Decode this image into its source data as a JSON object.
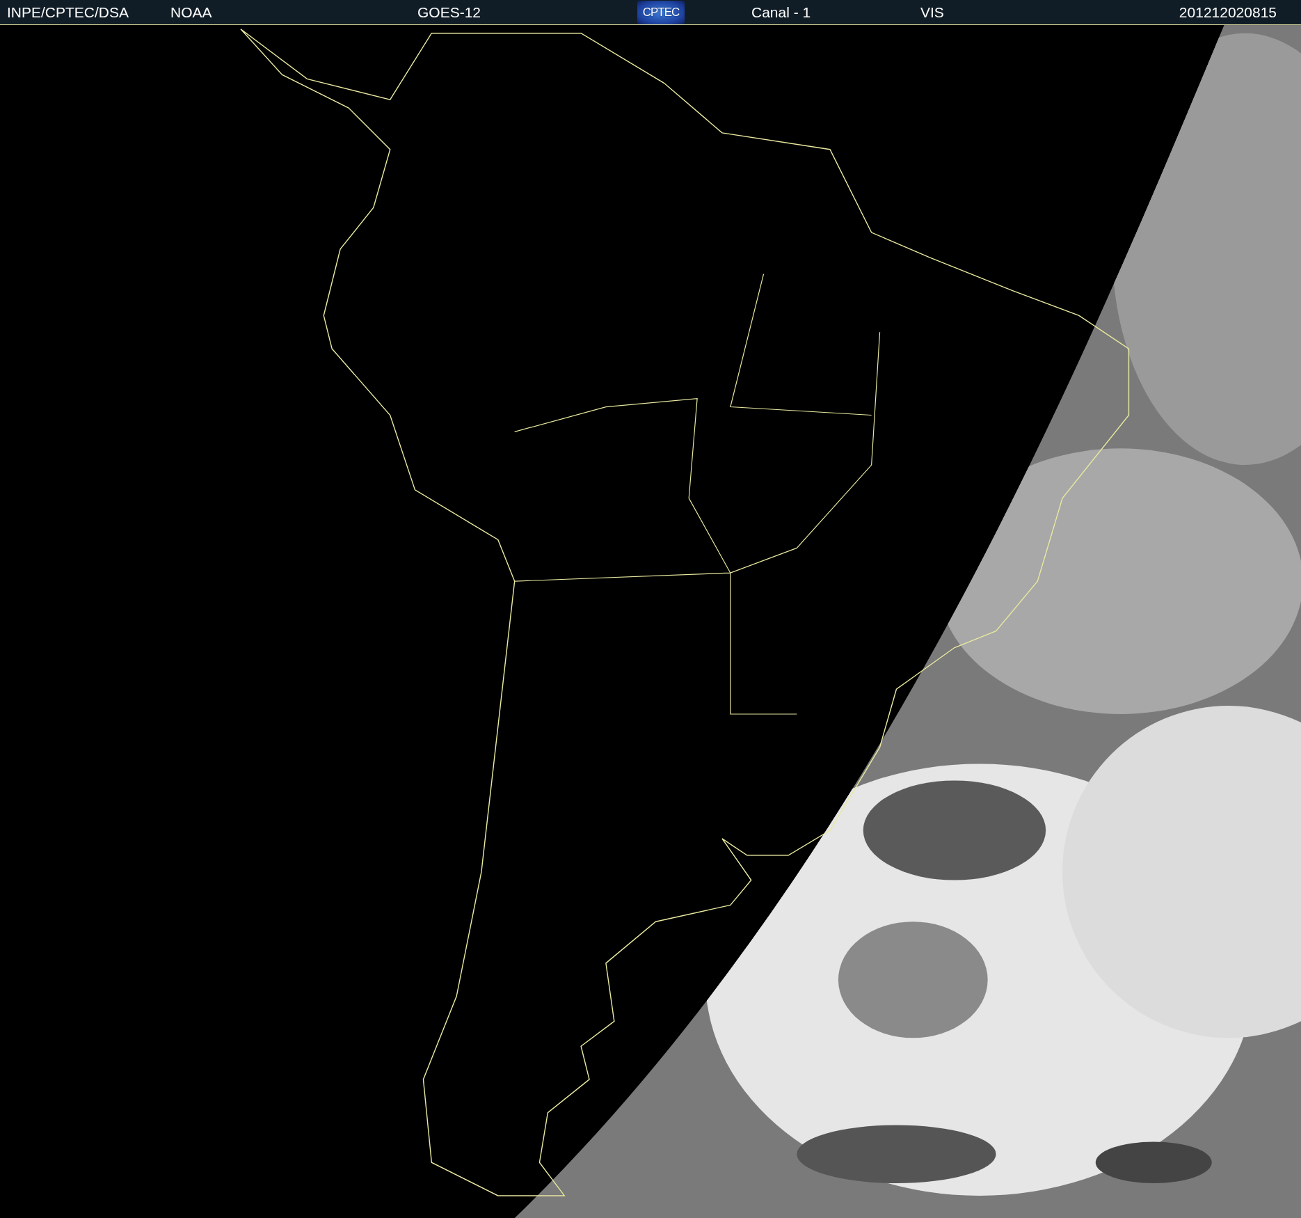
{
  "header": {
    "items": [
      {
        "kind": "text",
        "text": "INPE/CPTEC/DSA"
      },
      {
        "kind": "text",
        "text": "NOAA"
      },
      {
        "kind": "text",
        "text": "GOES-12"
      },
      {
        "kind": "logo",
        "text": "CPTEC"
      },
      {
        "kind": "text",
        "text": "Canal - 1"
      },
      {
        "kind": "text",
        "text": "VIS"
      },
      {
        "kind": "text",
        "text": "201212020815"
      }
    ]
  }
}
